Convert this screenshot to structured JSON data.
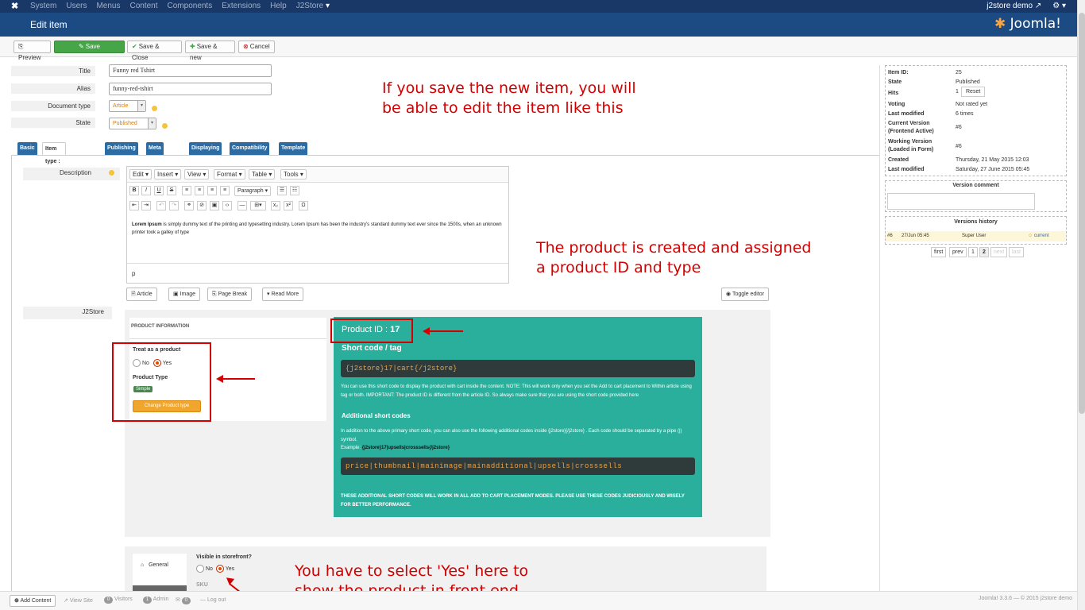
{
  "topnav": {
    "menu": [
      "System",
      "Users",
      "Menus",
      "Content",
      "Components",
      "Extensions",
      "Help",
      "J2Store"
    ],
    "user": "j2store demo",
    "settings_icon": "gear-icon"
  },
  "header": {
    "title": "Edit item",
    "brand": "Joomla!"
  },
  "toolbar": {
    "preview": "Preview",
    "save": "Save",
    "save_close": "Save & Close",
    "save_new": "Save & new",
    "cancel": "Cancel"
  },
  "form": {
    "title_label": "Title",
    "title_value": "Funny red Tshirt",
    "alias_label": "Alias",
    "alias_value": "funny-red-tshirt",
    "doctype_label": "Document type",
    "doctype_value": "Article",
    "state_label": "State",
    "state_value": "Published"
  },
  "tabs": [
    "Basic",
    "Item type : Article",
    "Publishing",
    "Meta / SEO",
    "Displaying",
    "Compatibility",
    "Template"
  ],
  "description": {
    "label": "Description",
    "menu": [
      "Edit",
      "Insert",
      "View",
      "Format",
      "Table",
      "Tools"
    ],
    "paragraph": "Paragraph",
    "content_bold": "Lorem Ipsum",
    "content_rest": " is simply dummy text of the printing and typesetting industry. Lorem Ipsum has been the industry's standard dummy text ever since the 1500s, when an unknown printer took a galley of type",
    "status": "p",
    "buttons": [
      "Article",
      "Image",
      "Page Break",
      "Read More"
    ],
    "toggle": "Toggle editor"
  },
  "j2store": {
    "label": "J2Store",
    "product_info": "PRODUCT INFORMATION",
    "treat_label": "Treat as a product",
    "no": "No",
    "yes": "Yes",
    "product_type_label": "Product Type",
    "product_type_value": "Simple",
    "change_type": "Change Product type",
    "product_id_label": "Product ID : ",
    "product_id_value": "17",
    "short_code_title": "Short code / tag",
    "short_code": "{j2store}17|cart{/j2store}",
    "note": "You can use this short code to display the product with cart inside the content. NOTE: This will work only when you set the Add to cart placement to Within article using tag or both. IMPORTANT: The product ID is different from the article ID. So always make sure that you are using the short code provided here",
    "additional_title": "Additional short codes",
    "additional_text": "In addition to the above primary short code, you can also use the following additional codes inside {j2store}{/j2store} . Each code should be separated by a pipe (|) symbol.",
    "example_label": "Example: ",
    "example_value": "{j2store}17|upsells|crosssells{/j2store}",
    "codes": "price|thumbnail|mainimage|mainadditional|upsells|crosssells",
    "warning": "THESE ADDITIONAL SHORT CODES WILL WORK IN ALL ADD TO CART PLACEMENT MODES. PLEASE USE THESE CODES JUDICIOUSLY AND WISELY FOR BETTER PERFORMANCE.",
    "general_tab": "General",
    "visible_label": "Visible in storefront?",
    "sku_label": "SKU"
  },
  "annotations": {
    "a1_l1": "If you save the new item, you will",
    "a1_l2": "be able to edit the item like this",
    "a2_l1": "The product is created and assigned",
    "a2_l2": "a product ID and type",
    "a3_l1": "You have to select 'Yes' here to",
    "a3_l2": "show the product in front end"
  },
  "sidebar": {
    "item_id_label": "Item ID:",
    "item_id": "25",
    "state_label": "State",
    "state": "Published",
    "hits_label": "Hits",
    "hits": "1",
    "reset": "Reset",
    "voting_label": "Voting",
    "voting": "Not rated yet",
    "lastmod_label": "Last modified",
    "lastmod_times": "6 times",
    "cur_ver_label": "Current Version",
    "cur_ver_sub": "(Frontend Active)",
    "cur_ver": "#6",
    "work_ver_label": "Working Version",
    "work_ver_sub": "(Loaded in Form)",
    "work_ver": "#6",
    "created_label": "Created",
    "created": "Thursday, 21 May 2015 12:03",
    "modified_label": "Last modified",
    "modified": "Saturday, 27 June 2015 05:45",
    "version_comment": "Version comment",
    "versions_history": "Versions history",
    "vh_num": "#6",
    "vh_date": "27/Jun 05:45",
    "vh_user": "Super User",
    "vh_status": "current",
    "pager": [
      "first",
      "prev",
      "1",
      "2",
      "next",
      "last"
    ]
  },
  "statusbar": {
    "add_content": "Add Content",
    "view_site": "View Site",
    "visitors_count": "0",
    "visitors": "Visitors",
    "admin_count": "1",
    "admin": "Admin",
    "msg_count": "0",
    "logout": "Log out",
    "footer": "Joomla! 3.3.6 — © 2015 j2store demo"
  }
}
